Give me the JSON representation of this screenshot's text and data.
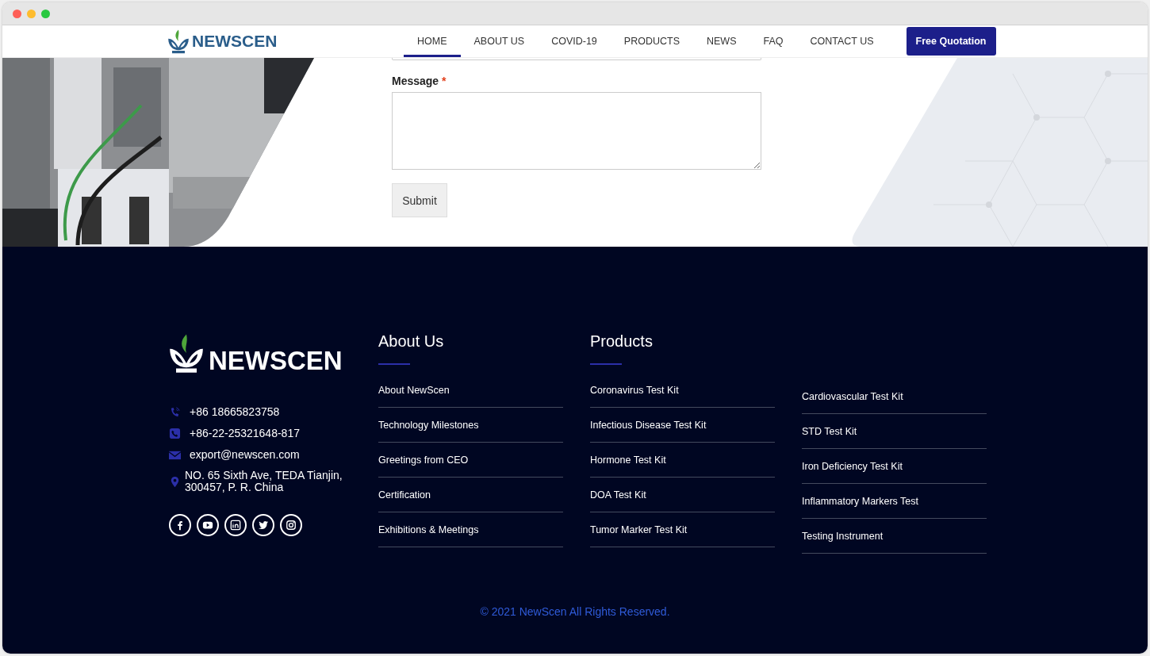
{
  "brand": {
    "name": "NEWSCEN"
  },
  "nav": [
    {
      "label": "HOME",
      "selected": true
    },
    {
      "label": "ABOUT US",
      "selected": false
    },
    {
      "label": "COVID-19",
      "selected": false
    },
    {
      "label": "PRODUCTS",
      "selected": false
    },
    {
      "label": "NEWS",
      "selected": false
    },
    {
      "label": "FAQ",
      "selected": false
    },
    {
      "label": "CONTACT US",
      "selected": false
    }
  ],
  "quote_button": "Free Quotation",
  "form": {
    "message_label": "Message",
    "required_mark": "*",
    "submit": "Submit"
  },
  "footer": {
    "logo": "NEWSCEN",
    "contacts": [
      {
        "kind": "mobile",
        "text": "+86 18665823758"
      },
      {
        "kind": "phone",
        "text": "+86-22-25321648-817"
      },
      {
        "kind": "email",
        "text": "export@newscen.com"
      },
      {
        "kind": "location",
        "text": "NO. 65 Sixth Ave, TEDA Tianjin, 300457, P. R. China"
      }
    ],
    "social": [
      {
        "kind": "facebook"
      },
      {
        "kind": "youtube"
      },
      {
        "kind": "linkedin"
      },
      {
        "kind": "twitter"
      },
      {
        "kind": "instagram"
      }
    ],
    "about": {
      "title": "About Us",
      "links": [
        "About NewScen",
        "Technology Milestones",
        "Greetings from CEO",
        "Certification",
        "Exhibitions & Meetings"
      ]
    },
    "products": {
      "title": "Products",
      "links": [
        "Coronavirus Test Kit",
        "Infectious Disease Test Kit",
        "Hormone Test Kit",
        "DOA Test Kit",
        "Tumor Marker Test Kit"
      ],
      "links_2": [
        "Cardiovascular Test Kit",
        "STD Test Kit",
        "Iron Deficiency Test Kit",
        "Inflammatory Markers Test",
        "Testing Instrument"
      ]
    },
    "copyright": "© 2021 NewScen All Rights Reserved."
  }
}
